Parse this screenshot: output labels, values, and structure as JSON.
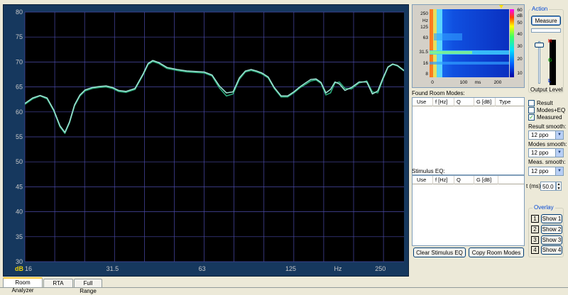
{
  "chart_data": {
    "type": "line",
    "ylabel": "dB",
    "xlabel": "Hz",
    "ylim": [
      30,
      80
    ],
    "yticks": [
      30,
      35,
      40,
      45,
      50,
      55,
      60,
      65,
      70,
      75,
      80
    ],
    "xlim": [
      16,
      300
    ],
    "xscale": "log",
    "xtick_labels": [
      {
        "value": 16,
        "label": "16"
      },
      {
        "value": 31.5,
        "label": "31.5"
      },
      {
        "value": 63,
        "label": "63"
      },
      {
        "value": 125,
        "label": "125"
      },
      {
        "value": 250,
        "label": "250"
      }
    ],
    "x_unit_label": {
      "value": 180,
      "label": "Hz"
    },
    "grid": true,
    "series": [
      {
        "color": "#2ca87a",
        "x": [
          16,
          17,
          18,
          19,
          20,
          21,
          21.8,
          22.6,
          23.5,
          24.5,
          25.5,
          27,
          28.5,
          30,
          31.5,
          33,
          35,
          37.5,
          40,
          41.5,
          43,
          45,
          48,
          52,
          56,
          60,
          64,
          68,
          72,
          76,
          80,
          84,
          88,
          92,
          96,
          100,
          105,
          110,
          116,
          122,
          128,
          134,
          140,
          146,
          152,
          158,
          164,
          170,
          176,
          182,
          190,
          200,
          212,
          225,
          235,
          245,
          255,
          265,
          275,
          285,
          300
        ],
        "y": [
          61.5,
          62.6,
          63.2,
          62.6,
          60.2,
          57.0,
          55.7,
          57.8,
          61.2,
          63.2,
          64.2,
          64.7,
          64.9,
          65.0,
          64.7,
          64.1,
          63.9,
          64.5,
          67.5,
          69.5,
          70.1,
          69.7,
          68.7,
          68.3,
          68.0,
          67.9,
          67.8,
          67.2,
          64.8,
          63.2,
          63.6,
          66.5,
          68.0,
          68.3,
          68.0,
          67.6,
          66.8,
          64.7,
          63.0,
          63.0,
          63.8,
          64.8,
          65.5,
          66.2,
          66.4,
          65.7,
          63.4,
          63.8,
          65.8,
          66.0,
          64.7,
          64.6,
          65.8,
          66.2,
          64.0,
          63.8,
          66.5,
          68.9,
          69.5,
          69.2,
          68.2
        ]
      },
      {
        "color": "#9adfd0",
        "x": [
          16,
          17,
          18,
          19,
          20,
          21,
          21.8,
          22.6,
          23.5,
          24.5,
          25.5,
          27,
          28.5,
          30,
          31.5,
          33,
          35,
          37.5,
          40,
          41.5,
          43,
          45,
          48,
          52,
          56,
          60,
          64,
          68,
          72,
          76,
          80,
          84,
          88,
          92,
          96,
          100,
          105,
          110,
          116,
          122,
          128,
          134,
          140,
          146,
          152,
          158,
          164,
          170,
          176,
          182,
          190,
          200,
          212,
          225,
          235,
          245,
          255,
          265,
          275,
          285,
          300
        ],
        "y": [
          61.7,
          62.8,
          63.3,
          62.8,
          60.4,
          57.2,
          55.9,
          58.0,
          61.4,
          63.4,
          64.4,
          64.9,
          65.1,
          65.2,
          64.9,
          64.3,
          64.1,
          64.7,
          67.7,
          69.7,
          70.3,
          69.9,
          68.9,
          68.5,
          68.2,
          68.1,
          68.0,
          67.4,
          65.2,
          63.8,
          64.0,
          66.8,
          68.2,
          68.5,
          68.2,
          67.8,
          67.0,
          64.9,
          63.2,
          63.2,
          64.0,
          65.0,
          65.8,
          66.5,
          66.6,
          65.9,
          63.8,
          64.5,
          66.0,
          65.6,
          64.3,
          64.9,
          66.0,
          66.0,
          63.6,
          64.2,
          66.8,
          69.0,
          69.6,
          69.3,
          68.3
        ]
      }
    ]
  },
  "spectrogram": {
    "y_labels": [
      "250",
      "Hz",
      "125",
      "63",
      "31.5",
      "16",
      "8"
    ],
    "x_labels": [
      "0",
      "100",
      "ms",
      "200"
    ],
    "scale_labels": [
      "60",
      "dB",
      "50",
      "40",
      "30",
      "20",
      "10"
    ]
  },
  "found_room_modes": {
    "title": "Found Room Modes:",
    "columns": [
      "Use",
      "f [Hz]",
      "Q",
      "G [dB]",
      "Type"
    ]
  },
  "stimulus_eq": {
    "title": "Stimulus EQ:",
    "columns": [
      "Use",
      "f [Hz]",
      "Q",
      "G [dB]"
    ]
  },
  "buttons": {
    "clear_eq": "Clear Stimulus EQ",
    "copy_modes": "Copy Room Modes",
    "measure": "Measure"
  },
  "action": {
    "title": "Action",
    "output_level": "Output Level",
    "meter_labels": [
      "H",
      "G",
      "L"
    ]
  },
  "options": {
    "result": {
      "label": "Result",
      "checked": false
    },
    "modes_eq": {
      "label": "Modes+EQ",
      "checked": false
    },
    "measured": {
      "label": "Measured",
      "checked": true
    },
    "result_smooth_label": "Result smooth:",
    "result_smooth": "12 ppo",
    "modes_smooth_label": "Modes smooth:",
    "modes_smooth": "12 ppo",
    "meas_smooth_label": "Meas. smooth:",
    "meas_smooth": "12 ppo",
    "t_label": "t (ms)",
    "t_value": "50.0"
  },
  "overlay": {
    "title": "Overlay",
    "items": [
      {
        "num": "1",
        "label": "Show 1"
      },
      {
        "num": "2",
        "label": "Show 2"
      },
      {
        "num": "3",
        "label": "Show 3"
      },
      {
        "num": "4",
        "label": "Show 4"
      }
    ]
  },
  "tabs": [
    "Room Analyzer",
    "RTA",
    "Full Range"
  ],
  "colors": {
    "plot_background": "#000000",
    "frame": "#16385e",
    "grid": "#4a4aa8",
    "tick_label": "#c8c8c8",
    "db_label": "#f0d200"
  }
}
